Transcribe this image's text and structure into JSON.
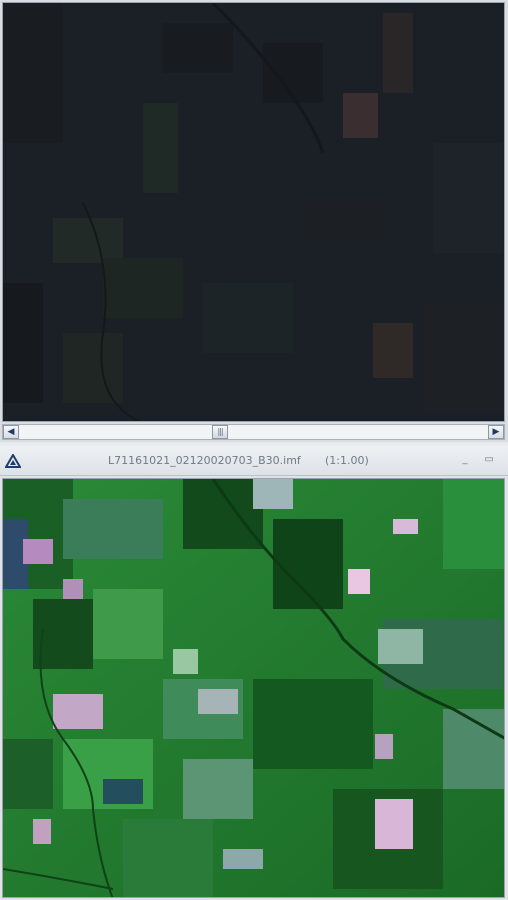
{
  "top_viewer": {
    "scrollbar": {
      "left_arrow_icon": "arrow-left-icon",
      "right_arrow_icon": "arrow-right-icon",
      "thumb_grip_icon": "grip-icon",
      "thumb_position": 0.4
    }
  },
  "bottom_window": {
    "title": "L71161021_02120020703_B30.imf",
    "scale": "(1:1.00)",
    "app_icon": "triangle-logo-icon",
    "minimize_icon": "minimize-icon",
    "maximize_icon": "maximize-icon"
  },
  "colors": {
    "dark_image_base": "#1c2127",
    "green_image_base": "#1d6a2a",
    "window_chrome": "#dfe3e7",
    "scroll_arrow": "#203a64"
  }
}
